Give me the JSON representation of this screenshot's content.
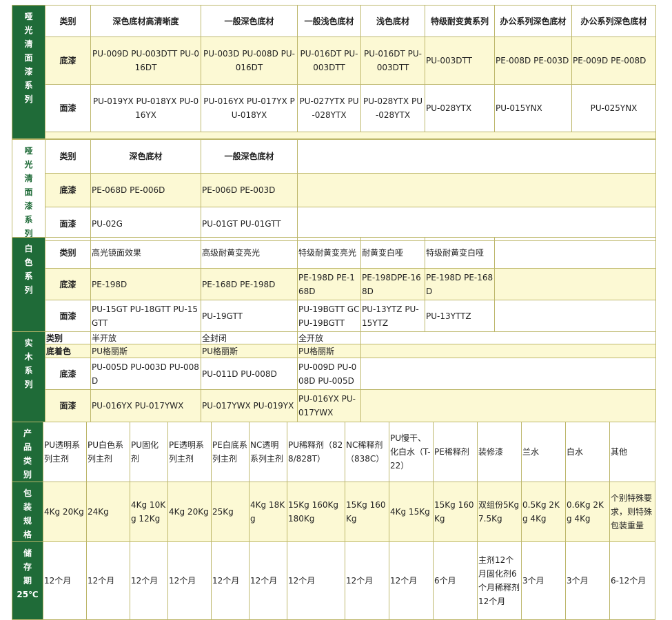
{
  "b1": {
    "side": "哑光清面漆系列",
    "hdr": [
      "类别",
      "深色底材高清晰度",
      "一般深色底材",
      "一般浅色底材",
      "浅色底材",
      "特级耐变黄系列",
      "办公系列深色底材",
      "办公系列深色底材"
    ],
    "r1": [
      "底漆",
      "PU-009D PU-003DTT PU-016DT",
      "PU-003D PU-008D PU-016DT",
      "PU-016DT PU-003DTT",
      "PU-016DT PU-003DTT",
      "PU-003DTT",
      "PE-008D PE-003D",
      "PE-009D PE-008D"
    ],
    "r2": [
      "面漆",
      "PU-019YX PU-018YX PU-016YX",
      "PU-016YX PU-017YX PU-018YX",
      "PU-027YTX PU-028YTX",
      "PU-028YTX PU-028YTX",
      "PU-028YTX",
      "PU-015YNX",
      "PU-025YNX"
    ]
  },
  "b2": {
    "side": "哑光清面漆系列",
    "hdr": [
      "类别",
      "深色底材",
      "一般深色底材"
    ],
    "r1": [
      "底漆",
      "PE-068D PE-006D",
      "PE-006D PE-003D"
    ],
    "r2": [
      "面漆",
      "PU-02G",
      "PU-01GT PU-01GTT"
    ]
  },
  "b3": {
    "side": "白色系列",
    "hdr": [
      "类别",
      "高光镜面效果",
      "高级耐黄变亮光",
      "特级耐黄变亮光",
      "耐黄变白哑",
      "特级耐黄变白哑"
    ],
    "r1": [
      "底漆",
      "PE-198D",
      "PE-168D PE-198D",
      "PE-198D PE-168D",
      "PE-198DPE-168D",
      "PE-198D PE-168D"
    ],
    "r2": [
      "面漆",
      "PU-15GT PU-18GTT PU-15GTT",
      "PU-19GTT",
      "PU-19BGTT GCPU-19BGTT",
      "PU-13YTZ PU-15YTZ",
      "PU-13YTTZ"
    ]
  },
  "b4": {
    "side": "实木系列",
    "hdr": [
      "类别",
      "半开放",
      "全封闭",
      "全开放"
    ],
    "r0": [
      "底着色",
      "PU格丽斯",
      "PU格丽斯",
      "PU格丽斯"
    ],
    "r1": [
      "底漆",
      "PU-005D PU-003D PU-008D",
      "PU-011D PU-008D",
      "PU-009D PU-008D PU-005D"
    ],
    "r2": [
      "面漆",
      "PU-016YX PU-017YWX",
      "PU-017YWX PU-019YX",
      "PU-016YX PU-017YWX"
    ]
  },
  "b5": {
    "side_cat": "产品类别",
    "side_pack": "包装规格",
    "side_store": "储存期",
    "side_store_temp": "25℃",
    "cats": [
      "PU透明系列主剂",
      "PU白色系列主剂",
      "PU固化剂",
      "PE透明系列主剂",
      "PE白底系列主剂",
      "NC透明系列主剂",
      "PU稀释剂（828/828T）",
      "NC稀释剂（838C）",
      "PU慢干、化白水（T-22）",
      "PE稀释剂",
      "装修漆",
      "兰水",
      "白水",
      "其他"
    ],
    "packs": [
      "4Kg 20Kg",
      "24Kg",
      "4Kg 10Kg 12Kg",
      "4Kg 20Kg",
      "25Kg",
      "4Kg 18Kg",
      "15Kg 160Kg 180Kg",
      "15Kg 160Kg",
      "4Kg 15Kg",
      "15Kg 160Kg",
      "双组份5Kg 7.5Kg",
      "0.5Kg 2Kg 4Kg",
      "0.6Kg 2Kg 4Kg",
      "个别特殊要求，则特殊包装重量"
    ],
    "store": [
      "12个月",
      "12个月",
      "12个月",
      "12个月",
      "12个月",
      "12个月",
      "12个月",
      "12个月",
      "12个月",
      "6个月",
      "主剂12个月固化剂6个月稀释剂12个月",
      "3个月",
      "3个月",
      "6-12个月"
    ]
  }
}
